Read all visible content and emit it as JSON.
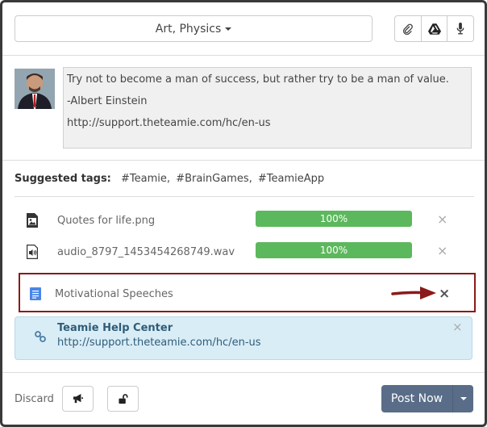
{
  "header": {
    "groups_label": "Art, Physics",
    "tools": [
      {
        "icon": "paperclip-icon"
      },
      {
        "icon": "google-drive-icon"
      },
      {
        "icon": "microphone-icon"
      }
    ]
  },
  "composer": {
    "message_lines": [
      "Try not to become a man of success, but rather try to be a man of value.",
      "-Albert Einstein",
      "http://support.theteamie.com/hc/en-us"
    ]
  },
  "tags": {
    "label": "Suggested tags:",
    "items": [
      "#Teamie,",
      "#BrainGames,",
      "#TeamieApp"
    ]
  },
  "attachments": [
    {
      "name": "Quotes for life.png",
      "icon": "image-file-icon",
      "progress": "100%",
      "remove": "×"
    },
    {
      "name": "audio_8797_1453454268749.wav",
      "icon": "audio-file-icon",
      "progress": "100%",
      "remove": "×"
    }
  ],
  "google_doc": {
    "name": "Motivational Speeches",
    "icon": "google-doc-icon",
    "remove": "×",
    "highlight_color": "#8b1a1a"
  },
  "link_preview": {
    "title": "Teamie Help Center",
    "url": "http://support.theteamie.com/hc/en-us",
    "remove": "×"
  },
  "footer": {
    "discard_label": "Discard",
    "announce_icon": "megaphone-icon",
    "lock_icon": "unlock-icon",
    "post_label": "Post Now"
  },
  "colors": {
    "accent": "#5a6d88",
    "progress": "#5cb85c",
    "link_bg": "#d9edf7"
  }
}
